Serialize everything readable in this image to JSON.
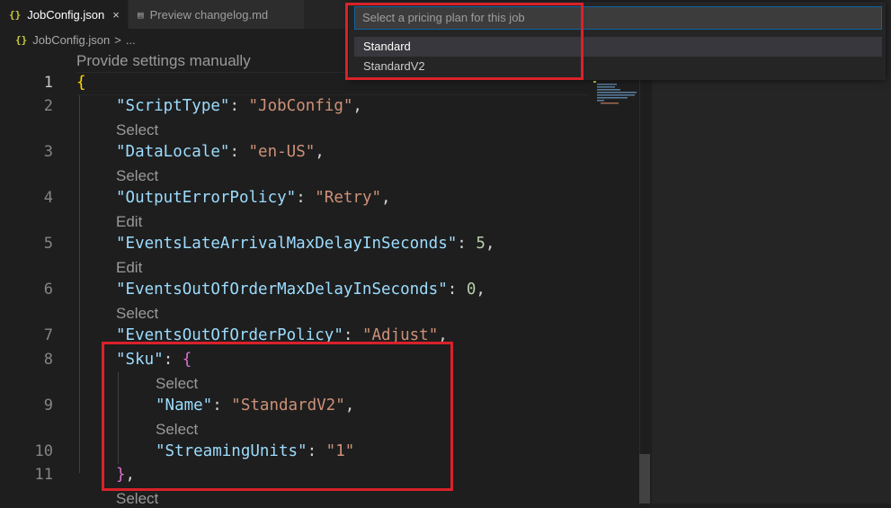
{
  "tabs": [
    {
      "icon": "{}",
      "label": "JobConfig.json",
      "close": "×",
      "active": true
    },
    {
      "icon": "▤",
      "label": "Preview changelog.md",
      "active": false
    }
  ],
  "breadcrumb": {
    "icon": "{}",
    "file": "JobConfig.json",
    "separator": ">",
    "more": "..."
  },
  "quick_pick": {
    "placeholder": "Select a pricing plan for this job",
    "items": [
      "Standard",
      "StandardV2"
    ]
  },
  "editor": {
    "codelens_top": "Provide settings manually",
    "line_numbers": [
      "1",
      "2",
      "3",
      "4",
      "5",
      "6",
      "7",
      "8",
      "9",
      "10",
      "11"
    ],
    "lines": {
      "l1_brace": "{",
      "l2_key": "\"ScriptType\"",
      "l2_val": "\"JobConfig\"",
      "l3_key": "\"DataLocale\"",
      "l3_val": "\"en-US\"",
      "l4_key": "\"OutputErrorPolicy\"",
      "l4_val": "\"Retry\"",
      "l5_key": "\"EventsLateArrivalMaxDelayInSeconds\"",
      "l5_val": "5",
      "l6_key": "\"EventsOutOfOrderMaxDelayInSeconds\"",
      "l6_val": "0",
      "l7_key": "\"EventsOutOfOrderPolicy\"",
      "l7_val": "\"Adjust\"",
      "l8_key": "\"Sku\"",
      "l8_brace": "{",
      "l9_key": "\"Name\"",
      "l9_val": "\"StandardV2\"",
      "l10_key": "\"StreamingUnits\"",
      "l10_val": "\"1\"",
      "l11_brace": "}"
    },
    "codelens": {
      "before_l3": "Select",
      "before_l4": "Select",
      "before_l5": "Edit",
      "before_l6": "Edit",
      "before_l7": "Select",
      "before_l9": "Select",
      "before_l10": "Select",
      "after_l11": "Select"
    }
  },
  "colors": {
    "highlight_box": "#d9222a",
    "accent": "#0e639c"
  }
}
